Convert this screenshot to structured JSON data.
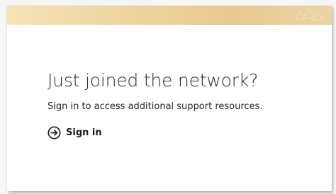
{
  "welcome_card": {
    "title": "Just joined the network?",
    "subtitle": "Sign in to access additional support resources.",
    "signin_label": "Sign in",
    "signin_icon": "arrow-circle-right-icon"
  },
  "colors": {
    "banner": "#ecd19b",
    "text": "#2b2b2b"
  }
}
